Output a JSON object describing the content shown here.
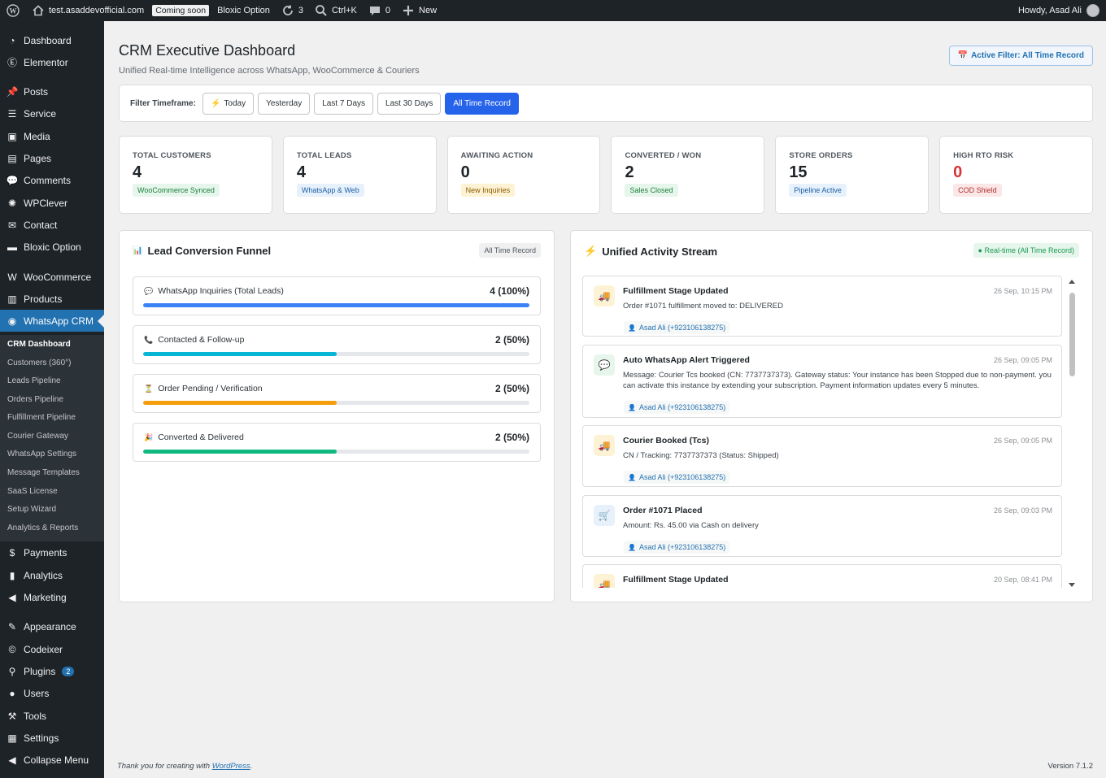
{
  "adminbar": {
    "site": "test.asaddevofficial.com",
    "coming_soon": "Coming soon",
    "plugin_link": "Bloxic Option",
    "updates": "3",
    "shortcut": "Ctrl+K",
    "comments": "0",
    "new_label": "New",
    "howdy": "Howdy, Asad Ali"
  },
  "sidebar": {
    "items": [
      {
        "label": "Dashboard",
        "icon": "dashboard-icon"
      },
      {
        "label": "Elementor",
        "icon": "elementor-icon"
      },
      {
        "label": "Posts",
        "icon": "pin-icon"
      },
      {
        "label": "Service",
        "icon": "list-icon"
      },
      {
        "label": "Media",
        "icon": "media-icon"
      },
      {
        "label": "Pages",
        "icon": "pages-icon"
      },
      {
        "label": "Comments",
        "icon": "comment-icon"
      },
      {
        "label": "WPClever",
        "icon": "lightbulb-icon"
      },
      {
        "label": "Contact",
        "icon": "mail-icon"
      },
      {
        "label": "Bloxic Option",
        "icon": "folder-icon"
      },
      {
        "label": "WooCommerce",
        "icon": "woo-icon"
      },
      {
        "label": "Products",
        "icon": "archive-icon"
      },
      {
        "label": "WhatsApp CRM",
        "icon": "chat-icon"
      },
      {
        "label": "Payments",
        "icon": "dollar-icon"
      },
      {
        "label": "Analytics",
        "icon": "bar-chart-icon"
      },
      {
        "label": "Marketing",
        "icon": "megaphone-icon"
      },
      {
        "label": "Appearance",
        "icon": "brush-icon"
      },
      {
        "label": "Codeixer",
        "icon": "codeixer-icon"
      },
      {
        "label": "Plugins",
        "icon": "plugin-icon",
        "badge": "2"
      },
      {
        "label": "Users",
        "icon": "user-icon"
      },
      {
        "label": "Tools",
        "icon": "wrench-icon"
      },
      {
        "label": "Settings",
        "icon": "settings-icon"
      },
      {
        "label": "Collapse Menu",
        "icon": "collapse-icon"
      }
    ],
    "submenu": [
      "CRM Dashboard",
      "Customers (360°)",
      "Leads Pipeline",
      "Orders Pipeline",
      "Fulfillment Pipeline",
      "Courier Gateway",
      "WhatsApp Settings",
      "Message Templates",
      "SaaS License",
      "Setup Wizard",
      "Analytics & Reports"
    ]
  },
  "header": {
    "title": "CRM Executive Dashboard",
    "subtitle": "Unified Real-time Intelligence across WhatsApp, WooCommerce & Couriers",
    "active_filter": "Active Filter: All Time Record"
  },
  "filters": {
    "label": "Filter Timeframe:",
    "options": [
      "Today",
      "Yesterday",
      "Last 7 Days",
      "Last 30 Days",
      "All Time Record"
    ],
    "selected": "All Time Record"
  },
  "stats": [
    {
      "label": "TOTAL CUSTOMERS",
      "value": "4",
      "tag": "WooCommerce Synced",
      "tag_bg": "#e7f6ec",
      "tag_color": "#1a7f37"
    },
    {
      "label": "TOTAL LEADS",
      "value": "4",
      "tag": "WhatsApp & Web",
      "tag_bg": "#e6f1fb",
      "tag_color": "#1f5fa8"
    },
    {
      "label": "AWAITING ACTION",
      "value": "0",
      "tag": "New Inquiries",
      "tag_bg": "#fdf3d4",
      "tag_color": "#8a5a00"
    },
    {
      "label": "CONVERTED / WON",
      "value": "2",
      "tag": "Sales Closed",
      "tag_bg": "#e7f6ec",
      "tag_color": "#1a7f37"
    },
    {
      "label": "STORE ORDERS",
      "value": "15",
      "tag": "Pipeline Active",
      "tag_bg": "#e6f1fb",
      "tag_color": "#1f5fa8"
    },
    {
      "label": "HIGH RTO RISK",
      "value": "0",
      "tag": "COD Shield",
      "tag_bg": "#fbe7e7",
      "tag_color": "#b32d2e"
    }
  ],
  "funnel": {
    "title": "Lead Conversion Funnel",
    "pill": "All Time Record",
    "rows": [
      {
        "label": "WhatsApp Inquiries (Total Leads)",
        "value": "4 (100%)",
        "fraction": 1.0,
        "color": "#3b82f6",
        "icon": "chat-bubble-icon"
      },
      {
        "label": "Contacted & Follow-up",
        "value": "2 (50%)",
        "fraction": 0.5,
        "color": "#06b6d4",
        "icon": "phone-icon"
      },
      {
        "label": "Order Pending / Verification",
        "value": "2 (50%)",
        "fraction": 0.5,
        "color": "#f59e0b",
        "icon": "hourglass-icon"
      },
      {
        "label": "Converted & Delivered",
        "value": "2 (50%)",
        "fraction": 0.5,
        "color": "#10b981",
        "icon": "party-icon"
      }
    ]
  },
  "activity": {
    "title": "Unified Activity Stream",
    "pill": "● Real-time (All Time Record)",
    "items": [
      {
        "title": "Fulfillment Stage Updated",
        "time": "26 Sep, 10:15 PM",
        "desc": "Order #1071 fulfillment moved to: DELIVERED",
        "user": "Asad Ali (+923106138275)",
        "icon": "truck-icon",
        "icon_bg": "#fdf3d4"
      },
      {
        "title": "Auto WhatsApp Alert Triggered",
        "time": "26 Sep, 09:05 PM",
        "desc": "Message: Courier Tcs booked (CN: 7737737373). Gateway status: Your instance has been Stopped due to non-payment. you can activate this instance by extending your subscription. Payment information updates every 5 minutes.",
        "user": "Asad Ali (+923106138275)",
        "icon": "chat-bubble-icon",
        "icon_bg": "#e7f6ec"
      },
      {
        "title": "Courier Booked (Tcs)",
        "time": "26 Sep, 09:05 PM",
        "desc": "CN / Tracking: 7737737373 (Status: Shipped)",
        "user": "Asad Ali (+923106138275)",
        "icon": "truck-icon",
        "icon_bg": "#fdf3d4"
      },
      {
        "title": "Order #1071 Placed",
        "time": "26 Sep, 09:03 PM",
        "desc": "Amount: Rs. 45.00 via Cash on delivery",
        "user": "Asad Ali (+923106138275)",
        "icon": "cart-icon",
        "icon_bg": "#e6f1fb"
      },
      {
        "title": "Fulfillment Stage Updated",
        "time": "20 Sep, 08:41 PM",
        "desc": "",
        "user": "",
        "icon": "truck-icon",
        "icon_bg": "#fdf3d4"
      }
    ]
  },
  "footer": {
    "thanks_prefix": "Thank you for creating with ",
    "thanks_link": "WordPress",
    "thanks_suffix": ".",
    "version": "Version 7.1.2"
  }
}
